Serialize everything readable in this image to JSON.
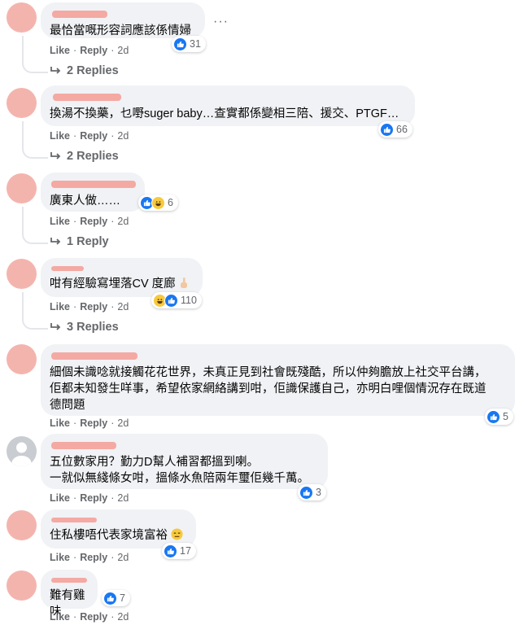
{
  "actions": {
    "like": "Like",
    "reply": "Reply",
    "dot": "·"
  },
  "more_label": "···",
  "comments": [
    {
      "text": "最恰當嘅形容詞應該係情婦",
      "reactions": "31",
      "time": "2d",
      "replies": "2 Replies"
    },
    {
      "text": "換湯不換藥，乜嘢suger baby…查實都係變相三陪、援交、PTGF…",
      "reactions": "66",
      "time": "2d",
      "replies": "2 Replies"
    },
    {
      "text": "廣東人做……",
      "reactions": "6",
      "time": "2d",
      "replies": "1 Reply"
    },
    {
      "text": "咁有經驗寫埋落CV 度廊",
      "reactions": "110",
      "time": "2d",
      "replies": "3 Replies"
    },
    {
      "text": "細個未識唸就接觸花花世界，未真正見到社會既殘酷，所以仲夠膽放上社交平台講，\n佢都未知發生咩事，希望依家網絡講到咁，佢識保護自己，亦明白哩個情況存在既道\n德問題",
      "reactions": "5",
      "time": "2d"
    },
    {
      "text": "五位數家用？勤力D幫人補習都搵到喇。\n一就似無綫條女咁，搵條水魚陪兩年璽佢幾千萬。",
      "reactions": "3",
      "time": "2d"
    },
    {
      "text": "住私樓唔代表家境富裕",
      "reactions": "17",
      "time": "2d"
    },
    {
      "text": "難有雞味",
      "reactions": "7",
      "time": "2d"
    }
  ],
  "colors": {
    "bubble": "#f0f2f5",
    "like": "#1877f2",
    "secondary_text": "#65676b",
    "avatar_placeholder": "#f4b4ae"
  }
}
